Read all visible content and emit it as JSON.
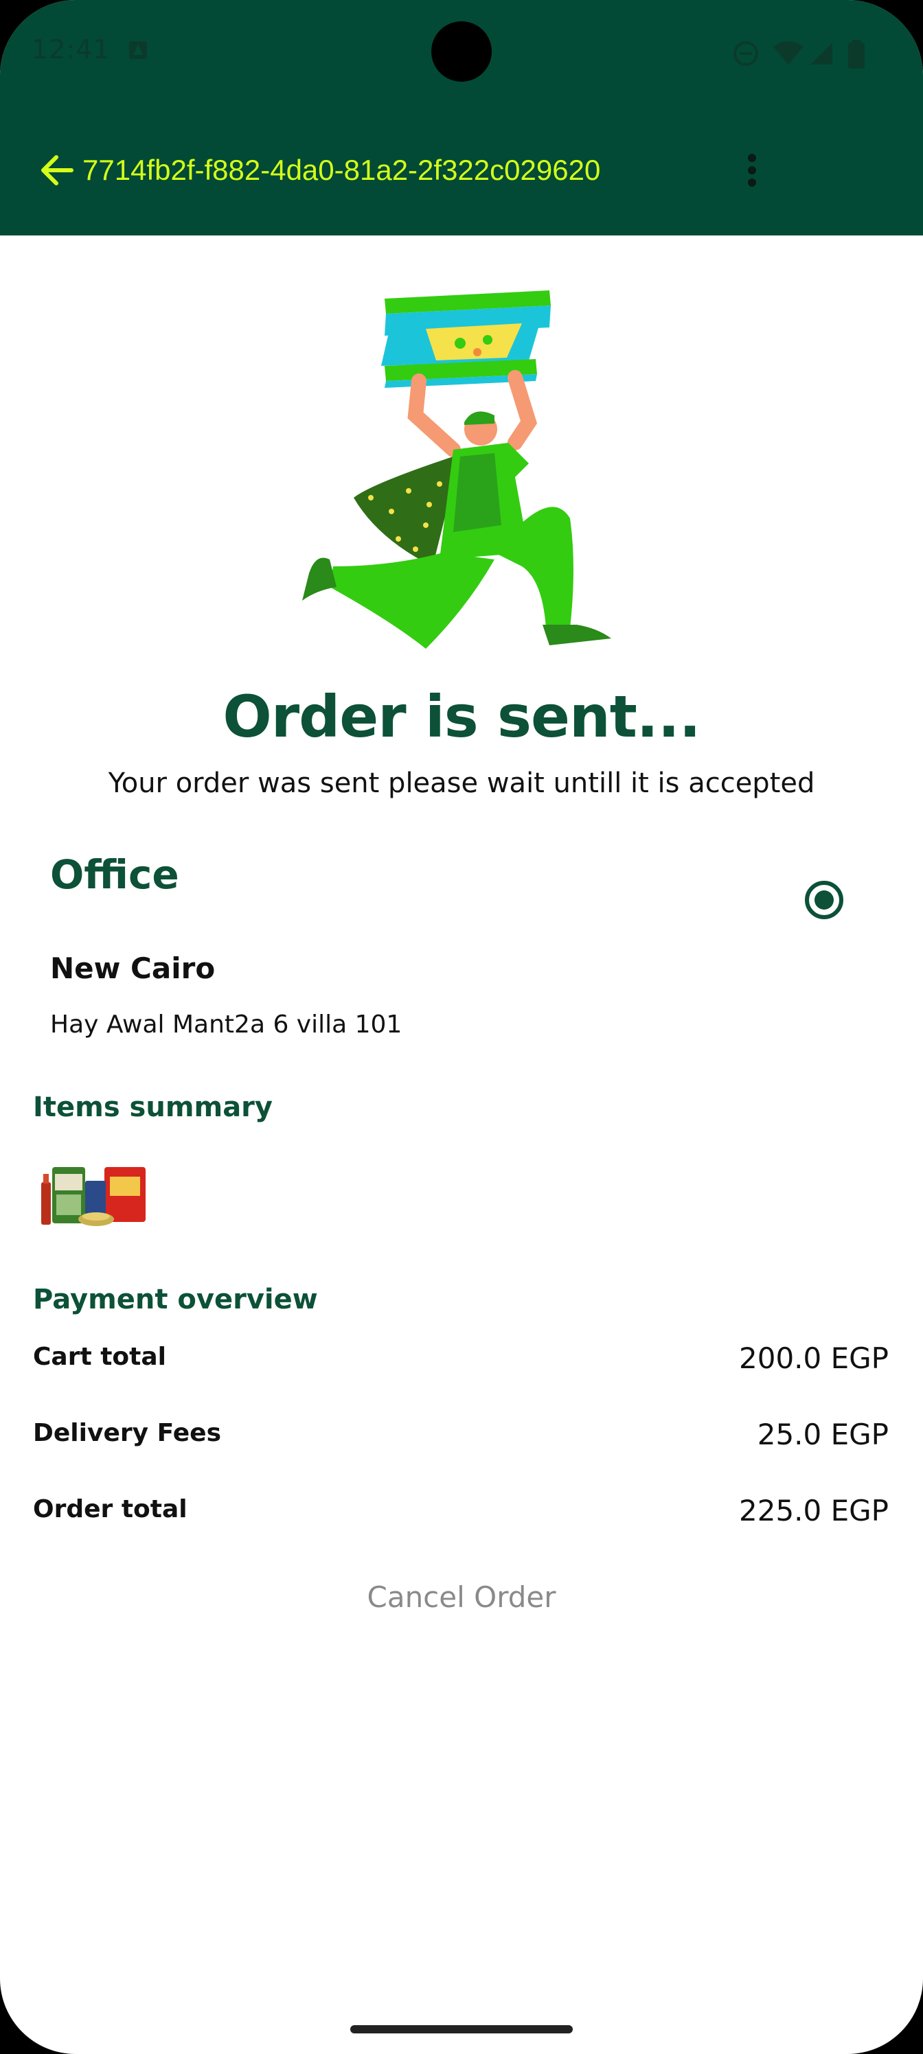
{
  "status_bar": {
    "time": "12:41"
  },
  "toolbar": {
    "title": "7714fb2f-f882-4da0-81a2-2f322c029620",
    "back_icon": "arrow-left-icon",
    "menu_icon": "more-vertical-icon"
  },
  "status": {
    "headline": "Order is sent...",
    "message": "Your order was sent please wait untill it is accepted"
  },
  "address": {
    "name": "Office",
    "area": "New Cairo",
    "line": "Hay Awal Mant2a 6 villa 101",
    "selected": true
  },
  "items_summary": {
    "title": "Items summary"
  },
  "payment": {
    "title": "Payment overview",
    "rows": [
      {
        "label": "Cart total",
        "value": "200.0 EGP"
      },
      {
        "label": "Delivery Fees",
        "value": "25.0 EGP"
      },
      {
        "label": "Order total",
        "value": "225.0 EGP"
      }
    ]
  },
  "actions": {
    "cancel_label": "Cancel Order"
  },
  "colors": {
    "appbar": "#024a35",
    "accent": "#d4ff1a",
    "primary_text": "#0c5138",
    "illustration_green": "#33cc11"
  }
}
